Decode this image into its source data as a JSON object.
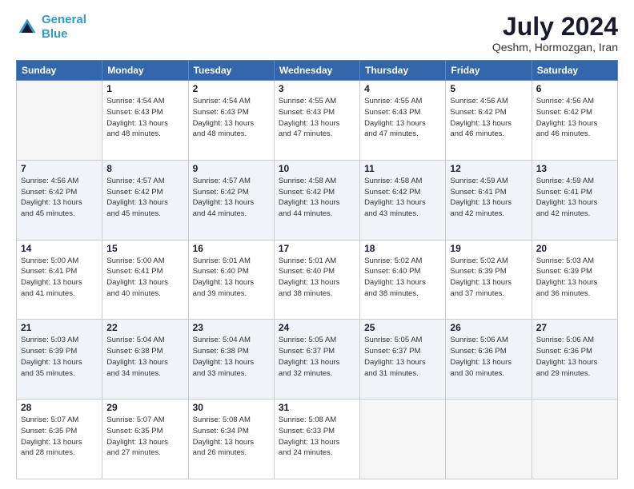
{
  "logo": {
    "line1": "General",
    "line2": "Blue"
  },
  "title": "July 2024",
  "location": "Qeshm, Hormozgan, Iran",
  "weekdays": [
    "Sunday",
    "Monday",
    "Tuesday",
    "Wednesday",
    "Thursday",
    "Friday",
    "Saturday"
  ],
  "weeks": [
    [
      {
        "day": "",
        "sunrise": "",
        "sunset": "",
        "daylight": ""
      },
      {
        "day": "1",
        "sunrise": "Sunrise: 4:54 AM",
        "sunset": "Sunset: 6:43 PM",
        "daylight": "Daylight: 13 hours and 48 minutes."
      },
      {
        "day": "2",
        "sunrise": "Sunrise: 4:54 AM",
        "sunset": "Sunset: 6:43 PM",
        "daylight": "Daylight: 13 hours and 48 minutes."
      },
      {
        "day": "3",
        "sunrise": "Sunrise: 4:55 AM",
        "sunset": "Sunset: 6:43 PM",
        "daylight": "Daylight: 13 hours and 47 minutes."
      },
      {
        "day": "4",
        "sunrise": "Sunrise: 4:55 AM",
        "sunset": "Sunset: 6:43 PM",
        "daylight": "Daylight: 13 hours and 47 minutes."
      },
      {
        "day": "5",
        "sunrise": "Sunrise: 4:56 AM",
        "sunset": "Sunset: 6:42 PM",
        "daylight": "Daylight: 13 hours and 46 minutes."
      },
      {
        "day": "6",
        "sunrise": "Sunrise: 4:56 AM",
        "sunset": "Sunset: 6:42 PM",
        "daylight": "Daylight: 13 hours and 46 minutes."
      }
    ],
    [
      {
        "day": "7",
        "sunrise": "Sunrise: 4:56 AM",
        "sunset": "Sunset: 6:42 PM",
        "daylight": "Daylight: 13 hours and 45 minutes."
      },
      {
        "day": "8",
        "sunrise": "Sunrise: 4:57 AM",
        "sunset": "Sunset: 6:42 PM",
        "daylight": "Daylight: 13 hours and 45 minutes."
      },
      {
        "day": "9",
        "sunrise": "Sunrise: 4:57 AM",
        "sunset": "Sunset: 6:42 PM",
        "daylight": "Daylight: 13 hours and 44 minutes."
      },
      {
        "day": "10",
        "sunrise": "Sunrise: 4:58 AM",
        "sunset": "Sunset: 6:42 PM",
        "daylight": "Daylight: 13 hours and 44 minutes."
      },
      {
        "day": "11",
        "sunrise": "Sunrise: 4:58 AM",
        "sunset": "Sunset: 6:42 PM",
        "daylight": "Daylight: 13 hours and 43 minutes."
      },
      {
        "day": "12",
        "sunrise": "Sunrise: 4:59 AM",
        "sunset": "Sunset: 6:41 PM",
        "daylight": "Daylight: 13 hours and 42 minutes."
      },
      {
        "day": "13",
        "sunrise": "Sunrise: 4:59 AM",
        "sunset": "Sunset: 6:41 PM",
        "daylight": "Daylight: 13 hours and 42 minutes."
      }
    ],
    [
      {
        "day": "14",
        "sunrise": "Sunrise: 5:00 AM",
        "sunset": "Sunset: 6:41 PM",
        "daylight": "Daylight: 13 hours and 41 minutes."
      },
      {
        "day": "15",
        "sunrise": "Sunrise: 5:00 AM",
        "sunset": "Sunset: 6:41 PM",
        "daylight": "Daylight: 13 hours and 40 minutes."
      },
      {
        "day": "16",
        "sunrise": "Sunrise: 5:01 AM",
        "sunset": "Sunset: 6:40 PM",
        "daylight": "Daylight: 13 hours and 39 minutes."
      },
      {
        "day": "17",
        "sunrise": "Sunrise: 5:01 AM",
        "sunset": "Sunset: 6:40 PM",
        "daylight": "Daylight: 13 hours and 38 minutes."
      },
      {
        "day": "18",
        "sunrise": "Sunrise: 5:02 AM",
        "sunset": "Sunset: 6:40 PM",
        "daylight": "Daylight: 13 hours and 38 minutes."
      },
      {
        "day": "19",
        "sunrise": "Sunrise: 5:02 AM",
        "sunset": "Sunset: 6:39 PM",
        "daylight": "Daylight: 13 hours and 37 minutes."
      },
      {
        "day": "20",
        "sunrise": "Sunrise: 5:03 AM",
        "sunset": "Sunset: 6:39 PM",
        "daylight": "Daylight: 13 hours and 36 minutes."
      }
    ],
    [
      {
        "day": "21",
        "sunrise": "Sunrise: 5:03 AM",
        "sunset": "Sunset: 6:39 PM",
        "daylight": "Daylight: 13 hours and 35 minutes."
      },
      {
        "day": "22",
        "sunrise": "Sunrise: 5:04 AM",
        "sunset": "Sunset: 6:38 PM",
        "daylight": "Daylight: 13 hours and 34 minutes."
      },
      {
        "day": "23",
        "sunrise": "Sunrise: 5:04 AM",
        "sunset": "Sunset: 6:38 PM",
        "daylight": "Daylight: 13 hours and 33 minutes."
      },
      {
        "day": "24",
        "sunrise": "Sunrise: 5:05 AM",
        "sunset": "Sunset: 6:37 PM",
        "daylight": "Daylight: 13 hours and 32 minutes."
      },
      {
        "day": "25",
        "sunrise": "Sunrise: 5:05 AM",
        "sunset": "Sunset: 6:37 PM",
        "daylight": "Daylight: 13 hours and 31 minutes."
      },
      {
        "day": "26",
        "sunrise": "Sunrise: 5:06 AM",
        "sunset": "Sunset: 6:36 PM",
        "daylight": "Daylight: 13 hours and 30 minutes."
      },
      {
        "day": "27",
        "sunrise": "Sunrise: 5:06 AM",
        "sunset": "Sunset: 6:36 PM",
        "daylight": "Daylight: 13 hours and 29 minutes."
      }
    ],
    [
      {
        "day": "28",
        "sunrise": "Sunrise: 5:07 AM",
        "sunset": "Sunset: 6:35 PM",
        "daylight": "Daylight: 13 hours and 28 minutes."
      },
      {
        "day": "29",
        "sunrise": "Sunrise: 5:07 AM",
        "sunset": "Sunset: 6:35 PM",
        "daylight": "Daylight: 13 hours and 27 minutes."
      },
      {
        "day": "30",
        "sunrise": "Sunrise: 5:08 AM",
        "sunset": "Sunset: 6:34 PM",
        "daylight": "Daylight: 13 hours and 26 minutes."
      },
      {
        "day": "31",
        "sunrise": "Sunrise: 5:08 AM",
        "sunset": "Sunset: 6:33 PM",
        "daylight": "Daylight: 13 hours and 24 minutes."
      },
      {
        "day": "",
        "sunrise": "",
        "sunset": "",
        "daylight": ""
      },
      {
        "day": "",
        "sunrise": "",
        "sunset": "",
        "daylight": ""
      },
      {
        "day": "",
        "sunrise": "",
        "sunset": "",
        "daylight": ""
      }
    ]
  ]
}
